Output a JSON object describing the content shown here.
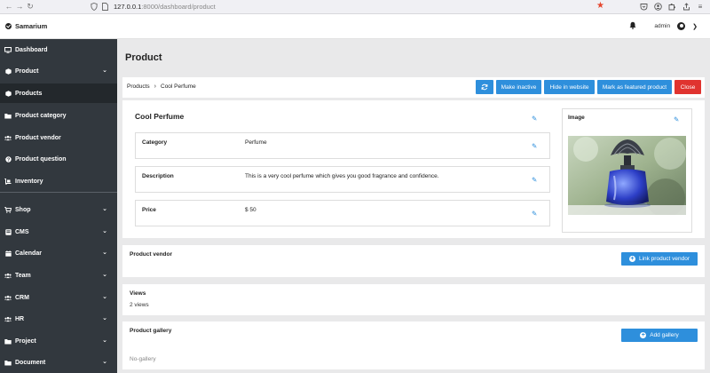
{
  "browser": {
    "url_host": "127.0.0.1",
    "url_path": ":8000/dashboard/product"
  },
  "header": {
    "brand": "Samarium",
    "user": "admin"
  },
  "sidebar": {
    "items": [
      {
        "label": "Dashboard",
        "icon": "monitor-icon",
        "chevron": false
      },
      {
        "label": "Product",
        "icon": "cube-icon",
        "chevron": true
      },
      {
        "label": "Products",
        "icon": "cube-icon",
        "chevron": false,
        "active": true
      },
      {
        "label": "Product category",
        "icon": "folder-icon",
        "chevron": false
      },
      {
        "label": "Product vendor",
        "icon": "users-icon",
        "chevron": false
      },
      {
        "label": "Product question",
        "icon": "question-icon",
        "chevron": false
      },
      {
        "label": "Inventory",
        "icon": "dolly-icon",
        "chevron": false
      },
      {
        "label": "Shop",
        "icon": "cart-icon",
        "chevron": true
      },
      {
        "label": "CMS",
        "icon": "cms-icon",
        "chevron": true
      },
      {
        "label": "Calendar",
        "icon": "calendar-icon",
        "chevron": true
      },
      {
        "label": "Team",
        "icon": "users-icon",
        "chevron": true
      },
      {
        "label": "CRM",
        "icon": "users-icon",
        "chevron": true
      },
      {
        "label": "HR",
        "icon": "users-icon",
        "chevron": true
      },
      {
        "label": "Project",
        "icon": "folder-icon",
        "chevron": true
      },
      {
        "label": "Document",
        "icon": "folder-icon",
        "chevron": true
      }
    ]
  },
  "page": {
    "title": "Product",
    "breadcrumb": [
      "Products",
      "Cool Perfume"
    ],
    "buttons": {
      "make_inactive": "Make inactive",
      "hide_website": "Hide in website",
      "featured": "Mark as featured product",
      "close": "Close"
    }
  },
  "product": {
    "name": "Cool Perfume",
    "fields": [
      {
        "label": "Category",
        "value": "Perfume"
      },
      {
        "label": "Description",
        "value": "This is a very cool perfume which gives you good fragrance and confidence."
      },
      {
        "label": "Price",
        "value": "$ 50"
      }
    ],
    "image_title": "Image"
  },
  "vendor": {
    "title": "Product vendor",
    "button": "Link product vendor"
  },
  "views": {
    "title": "Views",
    "count": "2 views"
  },
  "gallery": {
    "title": "Product gallery",
    "button": "Add gallery",
    "empty": "No-gallery"
  },
  "colors": {
    "sidebar": "#32383e",
    "sidebar_active": "#23282c",
    "primary": "#2e8fdc",
    "danger": "#e0332f"
  }
}
